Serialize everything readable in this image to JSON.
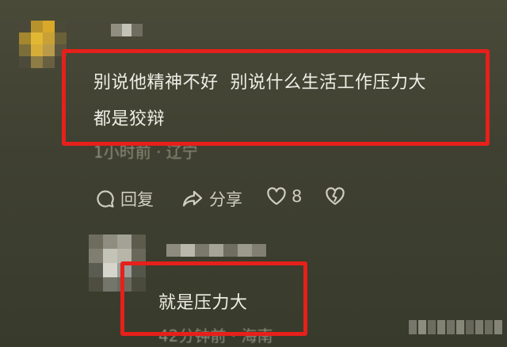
{
  "comment1": {
    "line1": "别说他精神不好  别说什么生活工作压力大",
    "line2": "都是狡辩",
    "meta": "1小时前 · 辽宁"
  },
  "actions": {
    "reply_label": "回复",
    "share_label": "分享",
    "like_count": "8",
    "icons": [
      "comment-bubble-icon",
      "share-arrow-icon",
      "heart-icon",
      "broken-heart-icon"
    ]
  },
  "comment2": {
    "text": "就是压力大",
    "meta": "42分钟前 · 海南"
  },
  "colors": {
    "highlight_border": "#e6201b",
    "background": "#3f4031",
    "text_primary": "#efeee6",
    "text_secondary": "#a6a593"
  }
}
